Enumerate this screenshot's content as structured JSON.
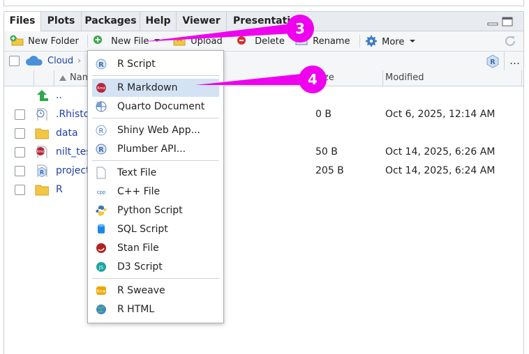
{
  "tabs": [
    "Files",
    "Plots",
    "Packages",
    "Help",
    "Viewer",
    "Presentation"
  ],
  "toolbar": {
    "new_folder": "New Folder",
    "new_file": "New File",
    "upload": "Upload",
    "delete": "Delete",
    "rename": "Rename",
    "more": "More"
  },
  "path": {
    "root": "Cloud"
  },
  "columns": {
    "name": "Name",
    "size": "Size",
    "modified": "Modified"
  },
  "files": [
    {
      "name": "..",
      "size": "",
      "modified": "",
      "icon": "up-arrow-icon"
    },
    {
      "name": ".Rhistory",
      "size": "0 B",
      "modified": "Oct 6, 2025, 12:14 AM",
      "icon": "rhistory-file-icon"
    },
    {
      "name": "data",
      "size": "",
      "modified": "",
      "icon": "folder-icon"
    },
    {
      "name": "nilt_test",
      "size": "50 B",
      "modified": "Oct 14, 2025, 6:26 AM",
      "icon": "rmarkdown-file-icon"
    },
    {
      "name": "project",
      "size": "205 B",
      "modified": "Oct 14, 2025, 6:24 AM",
      "icon": "rproject-file-icon"
    },
    {
      "name": "R",
      "size": "",
      "modified": "",
      "icon": "folder-icon"
    }
  ],
  "menu": [
    {
      "label": "R Script",
      "icon": "r-script-icon"
    },
    {
      "label": "R Markdown",
      "icon": "r-markdown-icon",
      "highlighted": true
    },
    {
      "label": "Quarto Document",
      "icon": "quarto-icon"
    },
    {
      "label": "Shiny Web App...",
      "icon": "shiny-icon"
    },
    {
      "label": "Plumber API...",
      "icon": "plumber-icon"
    },
    {
      "label": "Text File",
      "icon": "text-file-icon"
    },
    {
      "label": "C++ File",
      "icon": "cpp-icon"
    },
    {
      "label": "Python Script",
      "icon": "python-icon"
    },
    {
      "label": "SQL Script",
      "icon": "sql-icon"
    },
    {
      "label": "Stan File",
      "icon": "stan-icon"
    },
    {
      "label": "D3 Script",
      "icon": "d3-icon"
    },
    {
      "label": "R Sweave",
      "icon": "sweave-icon"
    },
    {
      "label": "R HTML",
      "icon": "r-html-icon"
    }
  ],
  "callouts": [
    "3",
    "4"
  ],
  "colors": {
    "callout": "#ef00ef",
    "link": "#1c3fa8",
    "highlight": "#d3e3f4",
    "r_blue": "#3c6eb4"
  }
}
